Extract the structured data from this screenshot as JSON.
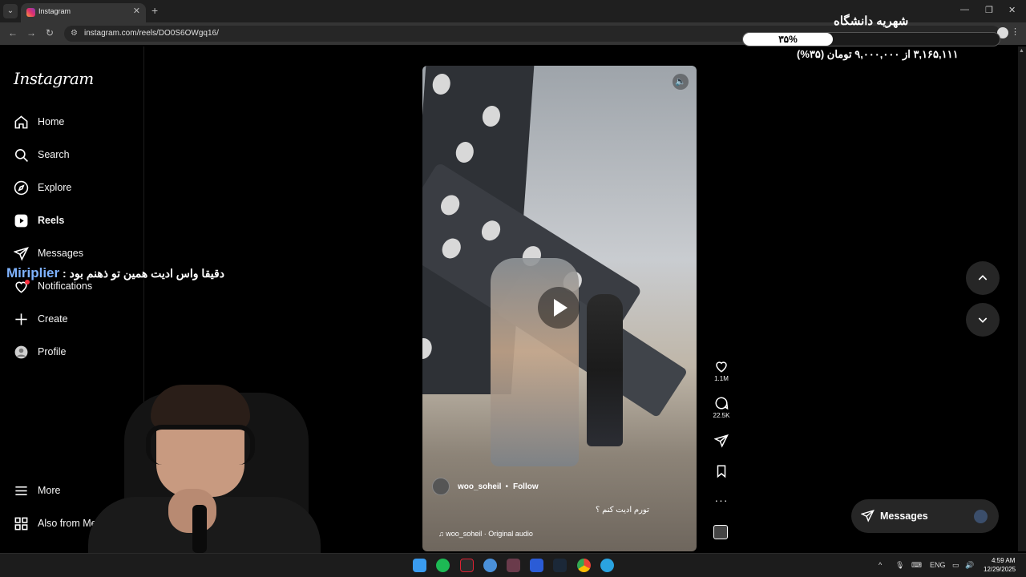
{
  "browser": {
    "tab_title": "Instagram",
    "url": "instagram.com/reels/DO0S6OWgq16/"
  },
  "sidebar": {
    "logo": "Instagram",
    "items": [
      {
        "label": "Home",
        "icon": "home-icon"
      },
      {
        "label": "Search",
        "icon": "search-icon"
      },
      {
        "label": "Explore",
        "icon": "compass-icon"
      },
      {
        "label": "Reels",
        "icon": "reels-icon",
        "active": true
      },
      {
        "label": "Messages",
        "icon": "send-icon"
      },
      {
        "label": "Notifications",
        "icon": "heart-icon"
      },
      {
        "label": "Create",
        "icon": "plus-icon"
      },
      {
        "label": "Profile",
        "icon": "profile-icon"
      }
    ],
    "more_label": "More",
    "meta_label": "Also from Meta"
  },
  "reel": {
    "author": "woo_soheil",
    "follow_label": "Follow",
    "caption": "تورم ادیت کنم ؟",
    "audio": "woo_soheil · Original audio"
  },
  "actions": {
    "likes": "1.1M",
    "comments": "22.5K"
  },
  "messages_pill": {
    "label": "Messages"
  },
  "overlay": {
    "donation_title": "شهریه دانشگاه",
    "donation_percent_label": "۳۵%",
    "donation_fraction": 0.35,
    "donation_amount": "۳,۱۶۵,۱۱۱ از ۹,۰۰۰,۰۰۰ تومان (۳۵%)",
    "chat_user": "Miriplier",
    "chat_text": " : دقیقا واس ادیت همین تو ذهنم بود"
  },
  "taskbar": {
    "language": "ENG",
    "time": "4:59 AM",
    "date": "12/29/2025"
  },
  "colors": {
    "background": "#000000",
    "panel": "#262626",
    "notification_dot": "#ff3040",
    "chat_user": "#7fb3ff"
  }
}
